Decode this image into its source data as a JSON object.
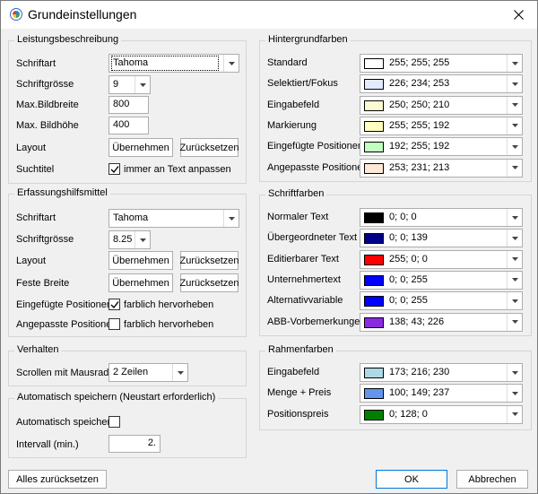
{
  "window": {
    "title": "Grundeinstellungen"
  },
  "leistung": {
    "title": "Leistungsbeschreibung",
    "schriftart_label": "Schriftart",
    "schriftart_value": "Tahoma",
    "schriftgroesse_label": "Schriftgrösse",
    "schriftgroesse_value": "9",
    "bildbreite_label": "Max.Bildbreite",
    "bildbreite_value": "800",
    "bildhoehe_label": "Max. Bildhöhe",
    "bildhoehe_value": "400",
    "layout_label": "Layout",
    "uebernehmen": "Übernehmen",
    "zuruecksetzen": "Zurücksetzen",
    "suchtitel_label": "Suchtitel",
    "suchtitel_check": "immer an Text anpassen",
    "suchtitel_checked": true
  },
  "erfassung": {
    "title": "Erfassungshilfsmittel",
    "schriftart_label": "Schriftart",
    "schriftart_value": "Tahoma",
    "schriftgroesse_label": "Schriftgrösse",
    "schriftgroesse_value": "8.25",
    "layout_label": "Layout",
    "feste_breite_label": "Feste Breite",
    "uebernehmen": "Übernehmen",
    "zuruecksetzen": "Zurücksetzen",
    "eingefuegte_label": "Eingefügte Positionen",
    "eingefuegte_check": "farblich hervorheben",
    "eingefuegte_checked": true,
    "angepasste_label": "Angepasste Positionen",
    "angepasste_check": "farblich hervorheben",
    "angepasste_checked": false
  },
  "verhalten": {
    "title": "Verhalten",
    "scrollen_label": "Scrollen mit Mausrad",
    "scrollen_value": "2 Zeilen"
  },
  "autosave": {
    "title": "Automatisch speichern (Neustart erforderlich)",
    "auto_label": "Automatisch speichern",
    "auto_checked": false,
    "intervall_label": "Intervall (min.)",
    "intervall_value": "2."
  },
  "hintergrund": {
    "title": "Hintergrundfarben",
    "items": [
      {
        "label": "Standard",
        "value": "255; 255; 255",
        "color": "#ffffff"
      },
      {
        "label": "Selektiert/Fokus",
        "value": "226; 234; 253",
        "color": "#e2eafd"
      },
      {
        "label": "Eingabefeld",
        "value": "250; 250; 210",
        "color": "#fafad2"
      },
      {
        "label": "Markierung",
        "value": "255; 255; 192",
        "color": "#ffffc0"
      },
      {
        "label": "Eingefügte Positionen",
        "value": "192; 255; 192",
        "color": "#c0ffc0"
      },
      {
        "label": "Angepasste Positionen",
        "value": "253; 231; 213",
        "color": "#fde7d5"
      }
    ]
  },
  "schrift": {
    "title": "Schriftfarben",
    "items": [
      {
        "label": "Normaler Text",
        "value": "0; 0; 0",
        "color": "#000000"
      },
      {
        "label": "Übergeordneter Text",
        "value": "0; 0; 139",
        "color": "#00008b"
      },
      {
        "label": "Editierbarer Text",
        "value": "255; 0; 0",
        "color": "#ff0000"
      },
      {
        "label": "Unternehmertext",
        "value": "0; 0; 255",
        "color": "#0000ff"
      },
      {
        "label": "Alternativvariable",
        "value": "0; 0; 255",
        "color": "#0000ff"
      },
      {
        "label": "ABB-Vorbemerkungen",
        "value": "138; 43; 226",
        "color": "#8a2be2"
      }
    ]
  },
  "rahmen": {
    "title": "Rahmenfarben",
    "items": [
      {
        "label": "Eingabefeld",
        "value": "173; 216; 230",
        "color": "#add8e6"
      },
      {
        "label": "Menge + Preis",
        "value": "100; 149; 237",
        "color": "#6495ed"
      },
      {
        "label": "Positionspreis",
        "value": "0; 128; 0",
        "color": "#008000"
      }
    ]
  },
  "footer": {
    "reset": "Alles zurücksetzen",
    "ok": "OK",
    "cancel": "Abbrechen"
  }
}
